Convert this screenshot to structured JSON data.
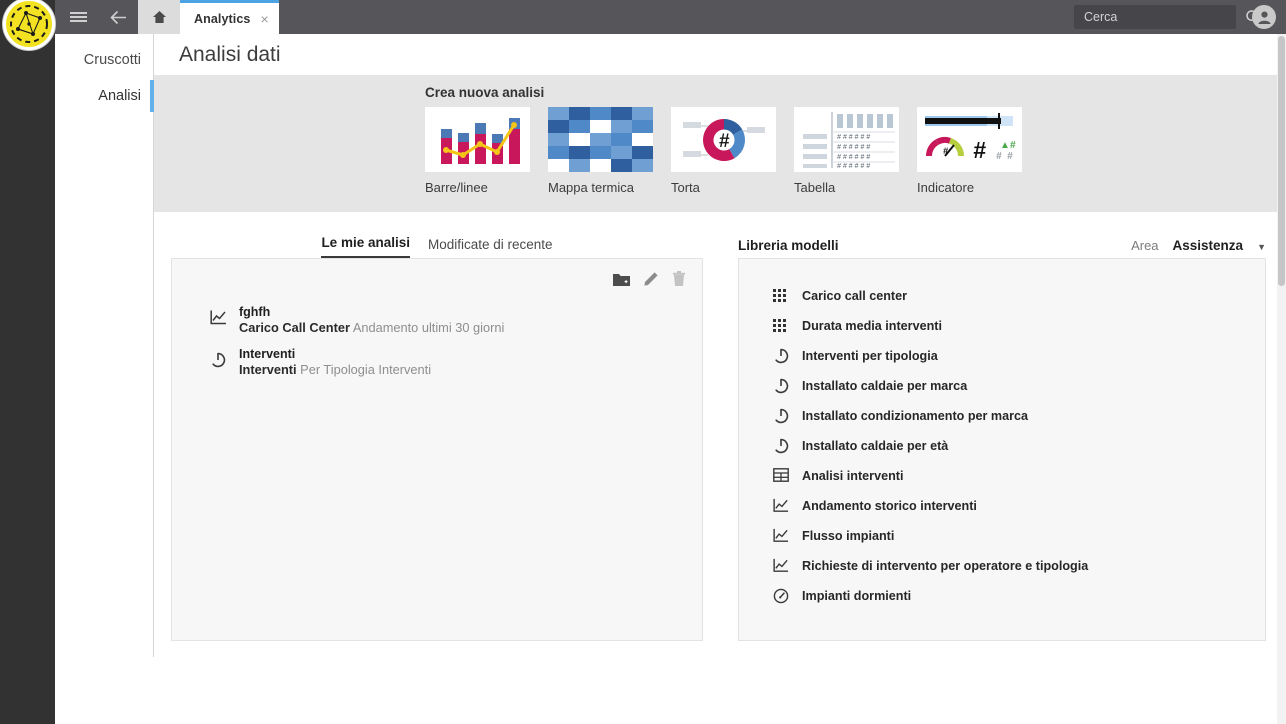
{
  "browser": {
    "menu_icon": "hamburger-icon",
    "back_icon": "back-arrow-icon",
    "home_icon": "home-icon",
    "tab_title": "Analytics",
    "tab_close": "×",
    "search_placeholder": "Cerca",
    "search_value": "",
    "search_icon": "search-icon",
    "avatar_icon": "user-avatar-icon",
    "chrome_bg": "#56565a"
  },
  "sidebar": {
    "items": [
      {
        "label": "Cruscotti",
        "active": false
      },
      {
        "label": "Analisi",
        "active": true
      }
    ],
    "active_color": "#64b0e8",
    "rail_color": "#323232"
  },
  "page": {
    "title": "Analisi dati"
  },
  "create": {
    "heading": "Crea nuova analisi",
    "items": [
      {
        "label": "Barre/linee",
        "icon": "bar-line-chart-thumbnail"
      },
      {
        "label": "Mappa termica",
        "icon": "heatmap-thumbnail"
      },
      {
        "label": "Torta",
        "icon": "pie-chart-thumbnail"
      },
      {
        "label": "Tabella",
        "icon": "table-thumbnail"
      },
      {
        "label": "Indicatore",
        "icon": "gauge-indicator-thumbnail"
      }
    ],
    "band_bg": "#e5e5e5"
  },
  "my_analyses": {
    "tabs": [
      {
        "label": "Le mie analisi",
        "active": true
      },
      {
        "label": "Modificate di recente",
        "active": false
      }
    ],
    "tools": [
      {
        "name": "new-folder-icon",
        "label": "Nuova cartella"
      },
      {
        "name": "edit-pencil-icon",
        "label": "Modifica"
      },
      {
        "name": "delete-trash-icon",
        "label": "Elimina"
      }
    ],
    "items": [
      {
        "title": "fghfh",
        "subject": "Carico Call Center",
        "description": "Andamento ultimi 30 giorni",
        "icon": "line-chart-icon"
      },
      {
        "title": "Interventi",
        "subject": "Interventi",
        "description": "Per Tipologia Interventi",
        "icon": "pie-chart-icon"
      }
    ]
  },
  "library": {
    "title": "Libreria modelli",
    "filter_label": "Area",
    "filter_value": "Assistenza",
    "caret_icon": "chevron-down-icon",
    "items": [
      {
        "label": "Carico call center",
        "icon": "grid-dots-icon"
      },
      {
        "label": "Durata media interventi",
        "icon": "grid-dots-icon"
      },
      {
        "label": "Interventi per tipologia",
        "icon": "pie-chart-icon"
      },
      {
        "label": "Installato caldaie per marca",
        "icon": "pie-chart-icon"
      },
      {
        "label": "Installato condizionamento per marca",
        "icon": "pie-chart-icon"
      },
      {
        "label": "Installato caldaie per età",
        "icon": "pie-chart-icon"
      },
      {
        "label": "Analisi interventi",
        "icon": "table-icon"
      },
      {
        "label": "Andamento storico interventi",
        "icon": "line-chart-icon"
      },
      {
        "label": "Flusso impianti",
        "icon": "line-chart-icon"
      },
      {
        "label": "Richieste di intervento per operatore e tipologia",
        "icon": "line-chart-icon"
      },
      {
        "label": "Impianti dormienti",
        "icon": "gauge-icon"
      }
    ]
  },
  "colors": {
    "accent_blue": "#64b0e8",
    "chart_crimson": "#c8175a",
    "chart_blue": "#4a79b5",
    "chart_yellow": "#f5c518"
  }
}
